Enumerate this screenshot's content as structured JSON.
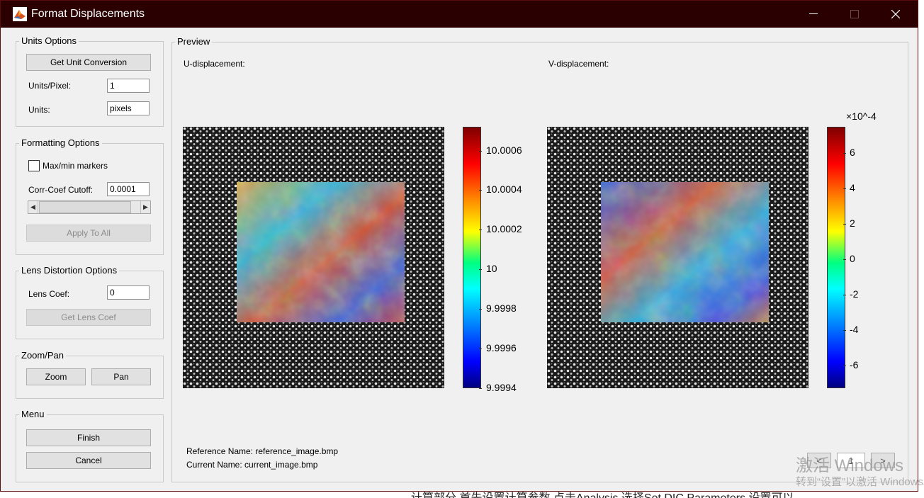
{
  "window": {
    "title": "Format Displacements"
  },
  "units_options": {
    "title": "Units Options",
    "get_unit_conversion": "Get Unit Conversion",
    "units_per_pixel_label": "Units/Pixel:",
    "units_per_pixel_value": "1",
    "units_label": "Units:",
    "units_value": "pixels"
  },
  "formatting_options": {
    "title": "Formatting Options",
    "max_min_label": "Max/min markers",
    "corr_coef_label": "Corr-Coef Cutoff:",
    "corr_coef_value": "0.0001",
    "apply_to_all": "Apply To All"
  },
  "lens_distortion": {
    "title": "Lens Distortion Options",
    "lens_coef_label": "Lens Coef:",
    "lens_coef_value": "0",
    "get_lens_coef": "Get Lens Coef"
  },
  "zoom_pan": {
    "title": "Zoom/Pan",
    "zoom": "Zoom",
    "pan": "Pan"
  },
  "menu": {
    "title": "Menu",
    "finish": "Finish",
    "cancel": "Cancel"
  },
  "preview": {
    "title": "Preview",
    "u_label": "U-displacement:",
    "v_label": "V-displacement:",
    "reference_name": "Reference Name: reference_image.bmp",
    "current_name": "Current Name: current_image.bmp",
    "pager": {
      "prev": "<",
      "page": "1",
      "next": ">"
    }
  },
  "chart_data": [
    {
      "type": "heatmap",
      "name": "U-displacement",
      "colorbar_ticks": [
        "10.0006",
        "10.0004",
        "10.0002",
        "10",
        "9.9998",
        "9.9996",
        "9.9994"
      ],
      "colorbar_range": [
        9.9994,
        10.00072
      ]
    },
    {
      "type": "heatmap",
      "name": "V-displacement",
      "colorbar_ticks": [
        "6",
        "4",
        "2",
        "0",
        "-2",
        "-4",
        "-6"
      ],
      "colorbar_exponent": "×10^-4",
      "colorbar_range": [
        -7.3,
        7.5
      ]
    }
  ],
  "watermark": {
    "line1": "激活 Windows",
    "line2": "转到“设置”以激活 Windows。"
  },
  "background_text": "计算部分 首先设置计算参数 点击Analysis 选择Set DIC Parameters 设置可以",
  "colors": {
    "titlebar": "#2b0000",
    "panel": "#f0f0f0"
  }
}
